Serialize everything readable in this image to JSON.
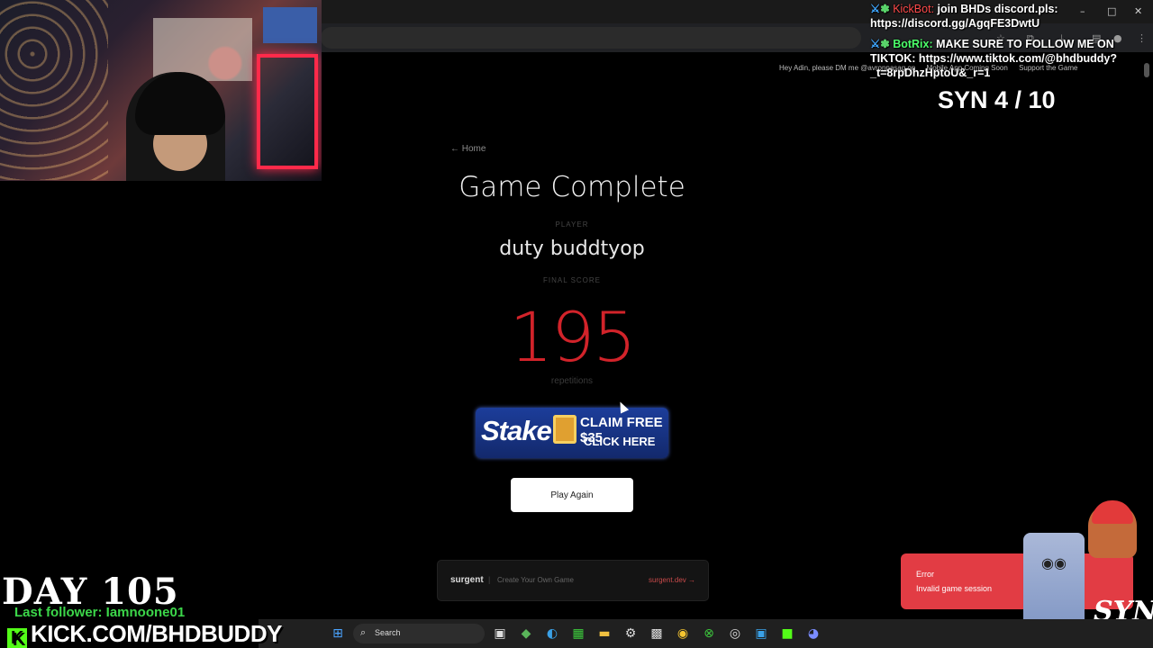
{
  "browser": {
    "window_controls": {
      "minimize": "–",
      "maximize": "□",
      "close": "✕"
    }
  },
  "stream": {
    "chat": [
      {
        "icon": "sword-icon",
        "badge": "star-badge-icon",
        "user": "KickBot:",
        "message": "join BHDs discord.pls: https://discord.gg/AgqFE3DwtU"
      },
      {
        "icon": "sword-icon",
        "badge": "star-badge-icon",
        "user": "BotRix:",
        "message": "MAKE SURE TO FOLLOW ME ON TIKTOK: https://www.tiktok.com/@bhdbuddy?_t=8rpDhzHptoU&_r=1"
      }
    ],
    "syn_counter": "SYN 4 / 10",
    "day_counter": "DAY 105",
    "last_follower": "Last follower: Iamnoone01",
    "kick_url": "KICK.COM/BHDBUDDY",
    "kick_logo": "K",
    "syn_logo": "SYN"
  },
  "site_nav": {
    "dm_note": "Hey Adin, please DM me @avronpasag on",
    "mobile_app": "Mobile App Coming Soon",
    "support": "Support the Game"
  },
  "game": {
    "back_link": "← Home",
    "title": "Game Complete",
    "player_label": "PLAYER",
    "player_name": "duty buddtyop",
    "score_label": "FINAL SCORE",
    "score": "195",
    "score_unit": "repetitions",
    "play_again": "Play Again"
  },
  "ad": {
    "brand": "Stake",
    "claim": "CLAIM FREE $35",
    "cta": "CLICK HERE"
  },
  "footer": {
    "brand": "surgent",
    "separator": "|",
    "tagline": "Create Your Own Game",
    "link": "surgent.dev →"
  },
  "toast": {
    "title": "Error",
    "message": "Invalid game session"
  },
  "taskbar": {
    "search_label": "Search"
  },
  "colors": {
    "score": "#d2232a",
    "toast_bg": "#e23c44",
    "kick_green": "#53fc18",
    "follower_green": "#3cd74a"
  }
}
